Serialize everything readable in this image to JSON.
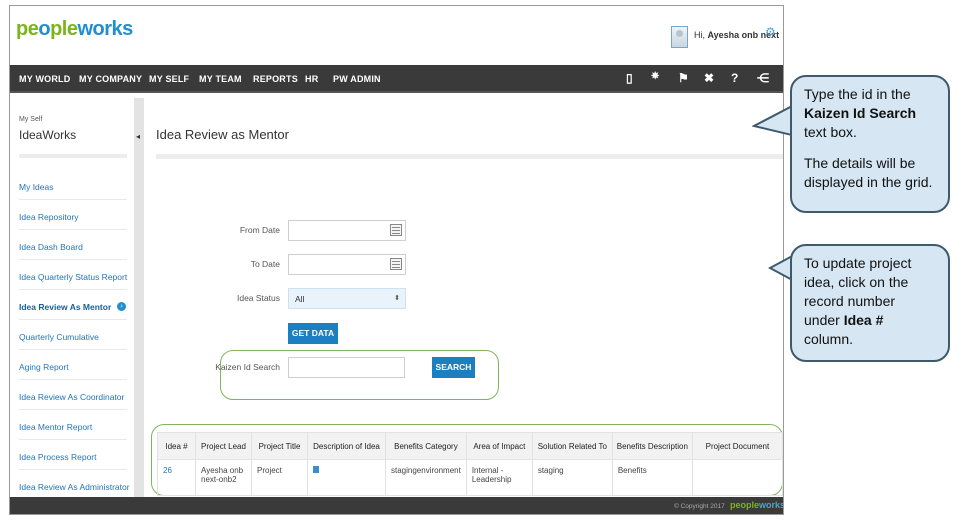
{
  "header": {
    "logo_part1": "pe",
    "logo_part2": "o",
    "logo_part3": "ple",
    "logo_part4": "works",
    "greeting_prefix": "Hi, ",
    "user_name": "Ayesha onb next"
  },
  "nav": {
    "items": [
      "MY WORLD",
      "MY COMPANY",
      "MY SELF",
      "MY TEAM",
      "REPORTS",
      "HR",
      "PW ADMIN"
    ],
    "icons": [
      "book-icon",
      "bulb-icon",
      "flag-icon",
      "tools-icon",
      "help-icon",
      "share-icon"
    ]
  },
  "sidebar": {
    "subtitle": "My Self",
    "title": "IdeaWorks",
    "items": [
      "My Ideas",
      "Idea Repository",
      "Idea Dash Board",
      "Idea Quarterly Status Report",
      "Idea Review As Mentor",
      "Quarterly Cumulative",
      "Aging Report",
      "Idea Review As Coordinator",
      "Idea Mentor Report",
      "Idea Process Report",
      "Idea Review As Administrator"
    ],
    "active_index": 4
  },
  "main": {
    "page_title": "Idea Review as Mentor",
    "from_date_label": "From Date",
    "to_date_label": "To Date",
    "idea_status_label": "Idea Status",
    "idea_status_value": "All",
    "get_data_label": "GET DATA",
    "kaizen_label": "Kaizen Id Search",
    "search_label": "SEARCH"
  },
  "table": {
    "columns": [
      "Idea #",
      "Project Lead",
      "Project Title",
      "Description of Idea",
      "Benefits Category",
      "Area of Impact",
      "Solution Related To",
      "Benefits Description",
      "Project Document"
    ],
    "rows": [
      {
        "idea_no": "26",
        "project_lead_1": "Ayesha onb",
        "project_lead_2": "next-onb2",
        "project_title": "Project",
        "benefits_category": "stagingenvironment",
        "area_1": "Internal -",
        "area_2": "Leadership",
        "solution": "staging",
        "benefits_description": "Benefits",
        "document": ""
      }
    ]
  },
  "footer": {
    "copyright": "© Copyright 2017",
    "logo_part1": "people",
    "logo_part2": "works"
  },
  "callouts": {
    "top_line1": "Type the id in the",
    "top_bold": "Kaizen Id Search",
    "top_line3": "text box.",
    "top_line4": "The details  will be",
    "top_line5": "displayed in the grid.",
    "bottom_line1": "To update project",
    "bottom_line2": "idea, click on the",
    "bottom_line3": "record number",
    "bottom_line4_prefix": "under ",
    "bottom_bold": "Idea #",
    "bottom_line5": "column."
  },
  "colors": {
    "nav_bg": "#3a3a3a",
    "accent_blue": "#1c7fc2",
    "logo_green": "#7cb518",
    "highlight_green": "#7fb55e",
    "callout_bg": "#d6e6f2"
  }
}
